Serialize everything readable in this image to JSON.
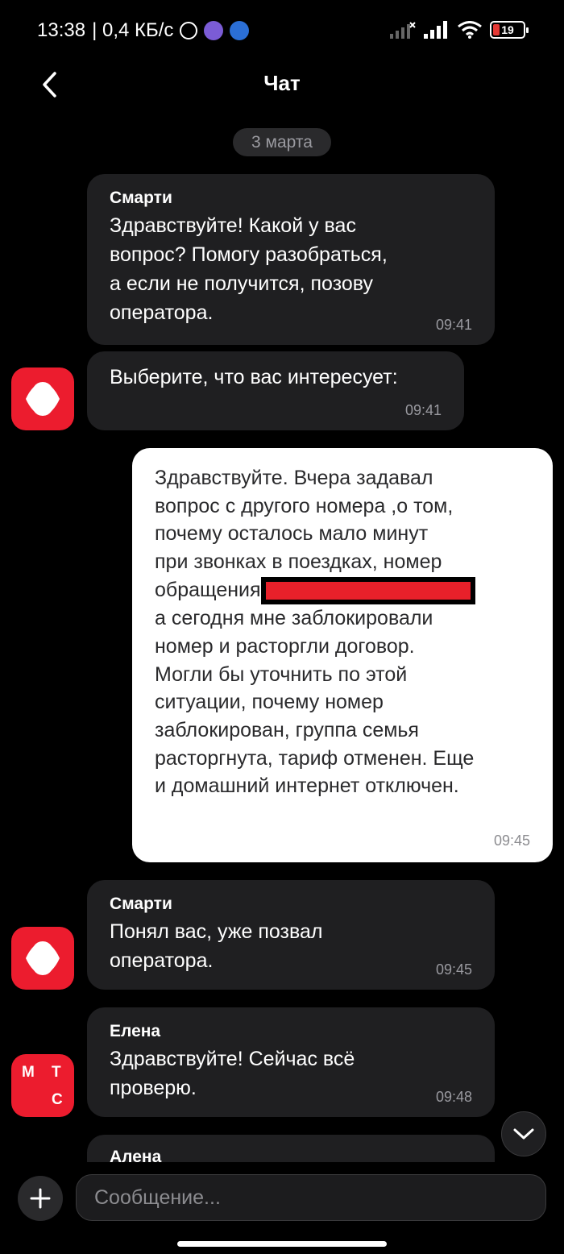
{
  "status_bar": {
    "time": "13:38",
    "speed": "| 0,4 КБ/с",
    "battery_level": "19"
  },
  "header": {
    "title": "Чат"
  },
  "date_label": "3 марта",
  "messages": [
    {
      "sender": "Смарти",
      "lines": [
        "Здравствуйте! Какой у вас",
        "вопрос? Помогу разобраться,",
        "а если не получится, позову",
        "оператора."
      ],
      "time": "09:41"
    },
    {
      "lines": [
        "Выберите, что вас интересует:"
      ],
      "time": "09:41"
    },
    {
      "outgoing": true,
      "lines": [
        "Здравствуйте. Вчера  задавал",
        "вопрос с другого номера ,о том,",
        "почему осталось мало минут",
        "при звонках  в поездках, номер",
        "обращения",
        "а сегодня мне заблокировали",
        "номер и расторгли договор.",
        "Могли бы уточнить по этой",
        "ситуации,  почему номер",
        "заблокирован, группа семья",
        "расторгнута, тариф отменен. Еще",
        "и домашний интернет отключен."
      ],
      "time": "09:45"
    },
    {
      "sender": "Смарти",
      "lines": [
        "Понял вас, уже позвал",
        "оператора."
      ],
      "time": "09:45"
    },
    {
      "sender": "Елена",
      "lines": [
        "Здравствуйте! Сейчас всё",
        "проверю."
      ],
      "time": "09:48"
    },
    {
      "sender": "Алена"
    }
  ],
  "avatar_mts": {
    "m": "М",
    "t": "Т",
    "s": "С"
  },
  "input": {
    "placeholder": "Сообщение..."
  },
  "colors": {
    "accent": "#ec1c2e",
    "bubble_in": "#1f1f21",
    "bubble_out": "#ffffff",
    "background": "#000000"
  }
}
